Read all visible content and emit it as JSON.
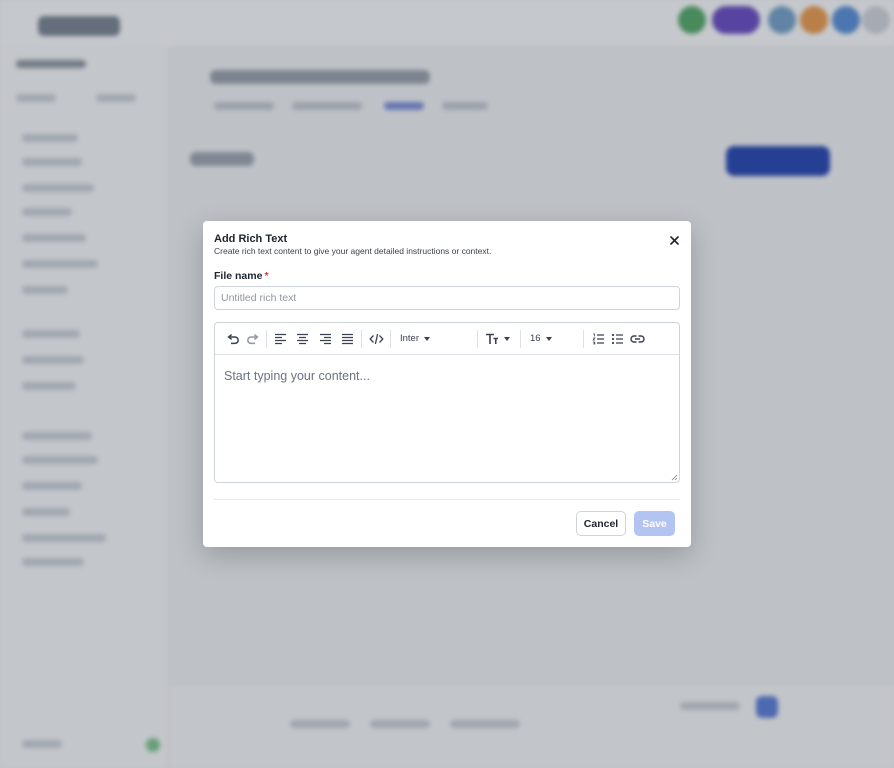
{
  "modal": {
    "title": "Add Rich Text",
    "subtitle": "Create rich text content to give your agent detailed instructions or context.",
    "close_icon": "close-icon",
    "file_name_label": "File name",
    "required_marker": "*",
    "file_name_placeholder": "Untitled rich text",
    "file_name_value": "",
    "toolbar": {
      "undo_icon": "undo-icon",
      "redo_icon": "redo-icon",
      "align_icons": [
        "align-left-icon",
        "align-center-icon",
        "align-right-icon",
        "align-justify-icon"
      ],
      "code_icon": "code-icon",
      "font_family": "Inter",
      "text_size_icon": "text-size-icon",
      "font_size": "16",
      "list_icons": [
        "ordered-list-icon",
        "bullet-list-icon"
      ],
      "link_icon": "link-icon"
    },
    "editor_placeholder": "Start typing your content...",
    "cancel_label": "Cancel",
    "save_label": "Save",
    "save_enabled": false
  },
  "colors": {
    "overlay": "#191e2a",
    "primary": "#2a48b0",
    "save_disabled": "#b4c4f2",
    "required": "#d93a3a"
  }
}
